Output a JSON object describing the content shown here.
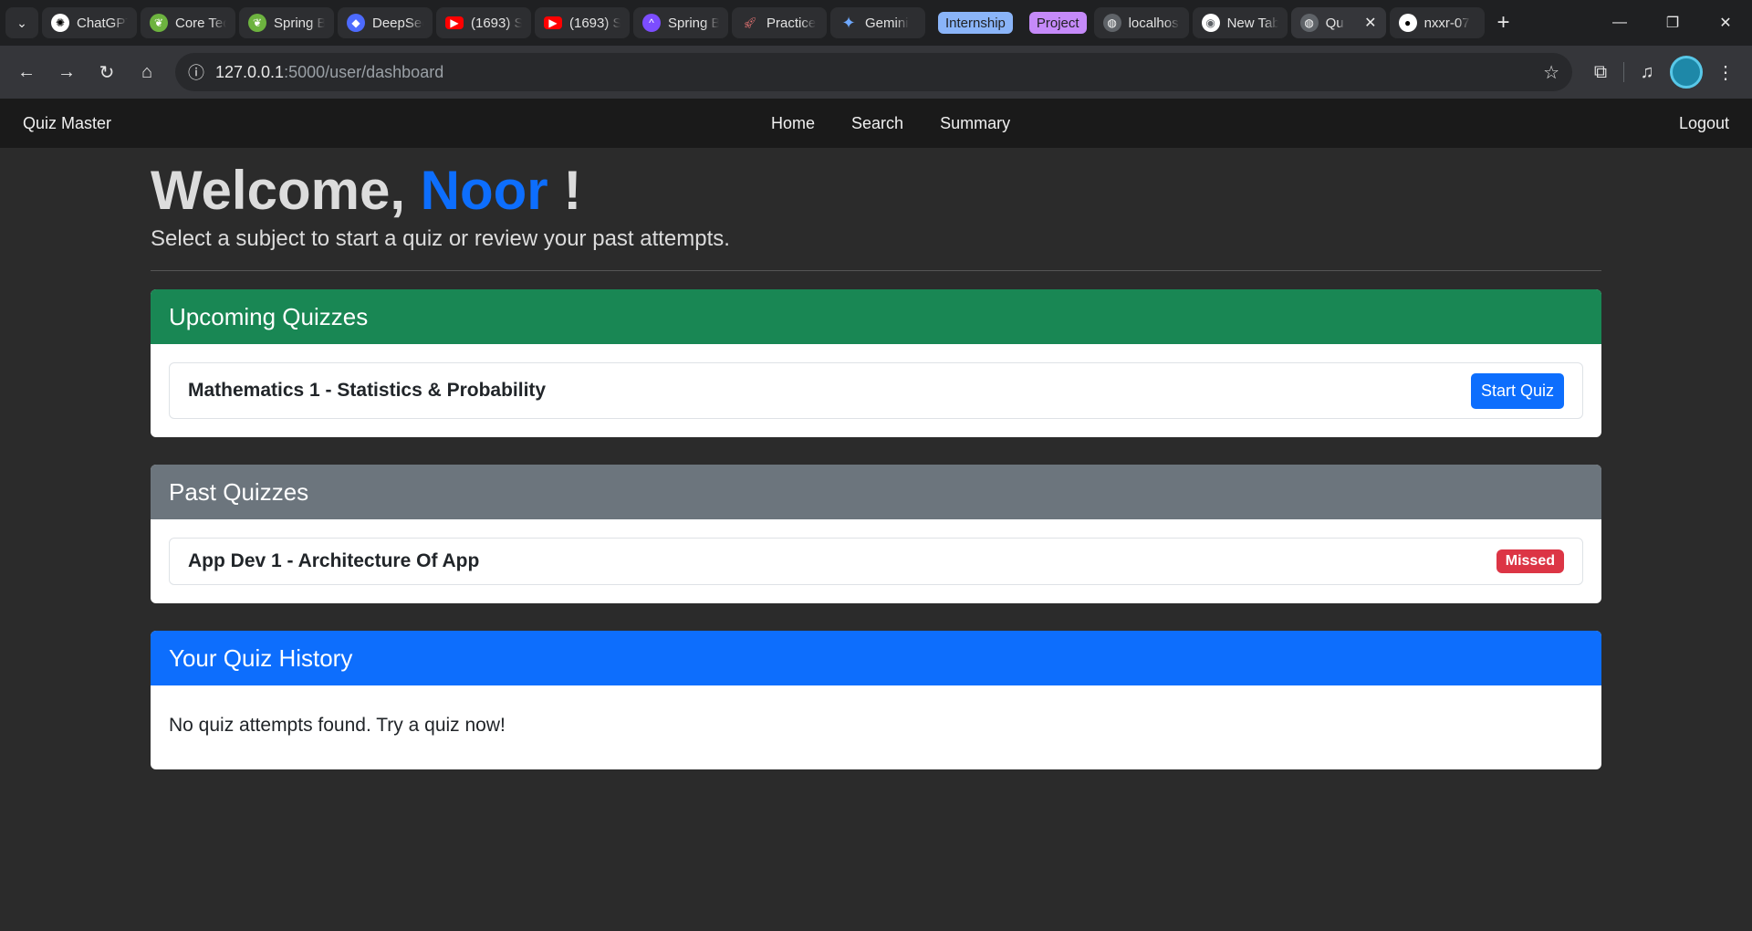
{
  "browser": {
    "tabs": [
      {
        "title": "ChatGPT",
        "icon": "chatgpt-icon"
      },
      {
        "title": "Core Tech",
        "icon": "spring-leaf-icon"
      },
      {
        "title": "Spring Boot",
        "icon": "spring-leaf-icon"
      },
      {
        "title": "DeepSeek",
        "icon": "deepseek-icon"
      },
      {
        "title": "(1693) S",
        "icon": "youtube-icon"
      },
      {
        "title": "(1693) S",
        "icon": "youtube-icon"
      },
      {
        "title": "Spring B",
        "icon": "spring-arrow-icon"
      },
      {
        "title": "Practice",
        "icon": "rocket-icon"
      },
      {
        "title": "Gemini",
        "icon": "gemini-icon"
      }
    ],
    "groups": [
      {
        "label": "Internship",
        "color": "#8ab4f8"
      },
      {
        "label": "Project",
        "color": "#c58af9"
      }
    ],
    "tabs2": [
      {
        "title": "localhost",
        "icon": "globe-icon"
      },
      {
        "title": "New Tab",
        "icon": "chrome-icon"
      },
      {
        "title": "Qu",
        "icon": "globe-icon",
        "active": true
      },
      {
        "title": "nxxr-07",
        "icon": "github-icon"
      }
    ],
    "url_host": "127.0.0.1",
    "url_rest": ":5000/user/dashboard"
  },
  "navbar": {
    "brand": "Quiz Master",
    "links": [
      "Home",
      "Search",
      "Summary"
    ],
    "logout": "Logout"
  },
  "welcome": {
    "prefix": "Welcome, ",
    "name": "Noor",
    "suffix": " !",
    "subtitle": "Select a subject to start a quiz or review your past attempts."
  },
  "upcoming": {
    "title": "Upcoming Quizzes",
    "items": [
      {
        "name": "Mathematics 1 - Statistics & Probability",
        "action": "Start Quiz"
      }
    ]
  },
  "past": {
    "title": "Past Quizzes",
    "items": [
      {
        "name": "App Dev 1 - Architecture Of App",
        "status": "Missed"
      }
    ]
  },
  "history": {
    "title": "Your Quiz History",
    "empty_message": "No quiz attempts found. Try a quiz now!"
  },
  "colors": {
    "accent": "#0d6efd",
    "success": "#198754",
    "secondary": "#6c757d",
    "danger": "#dc3545"
  }
}
